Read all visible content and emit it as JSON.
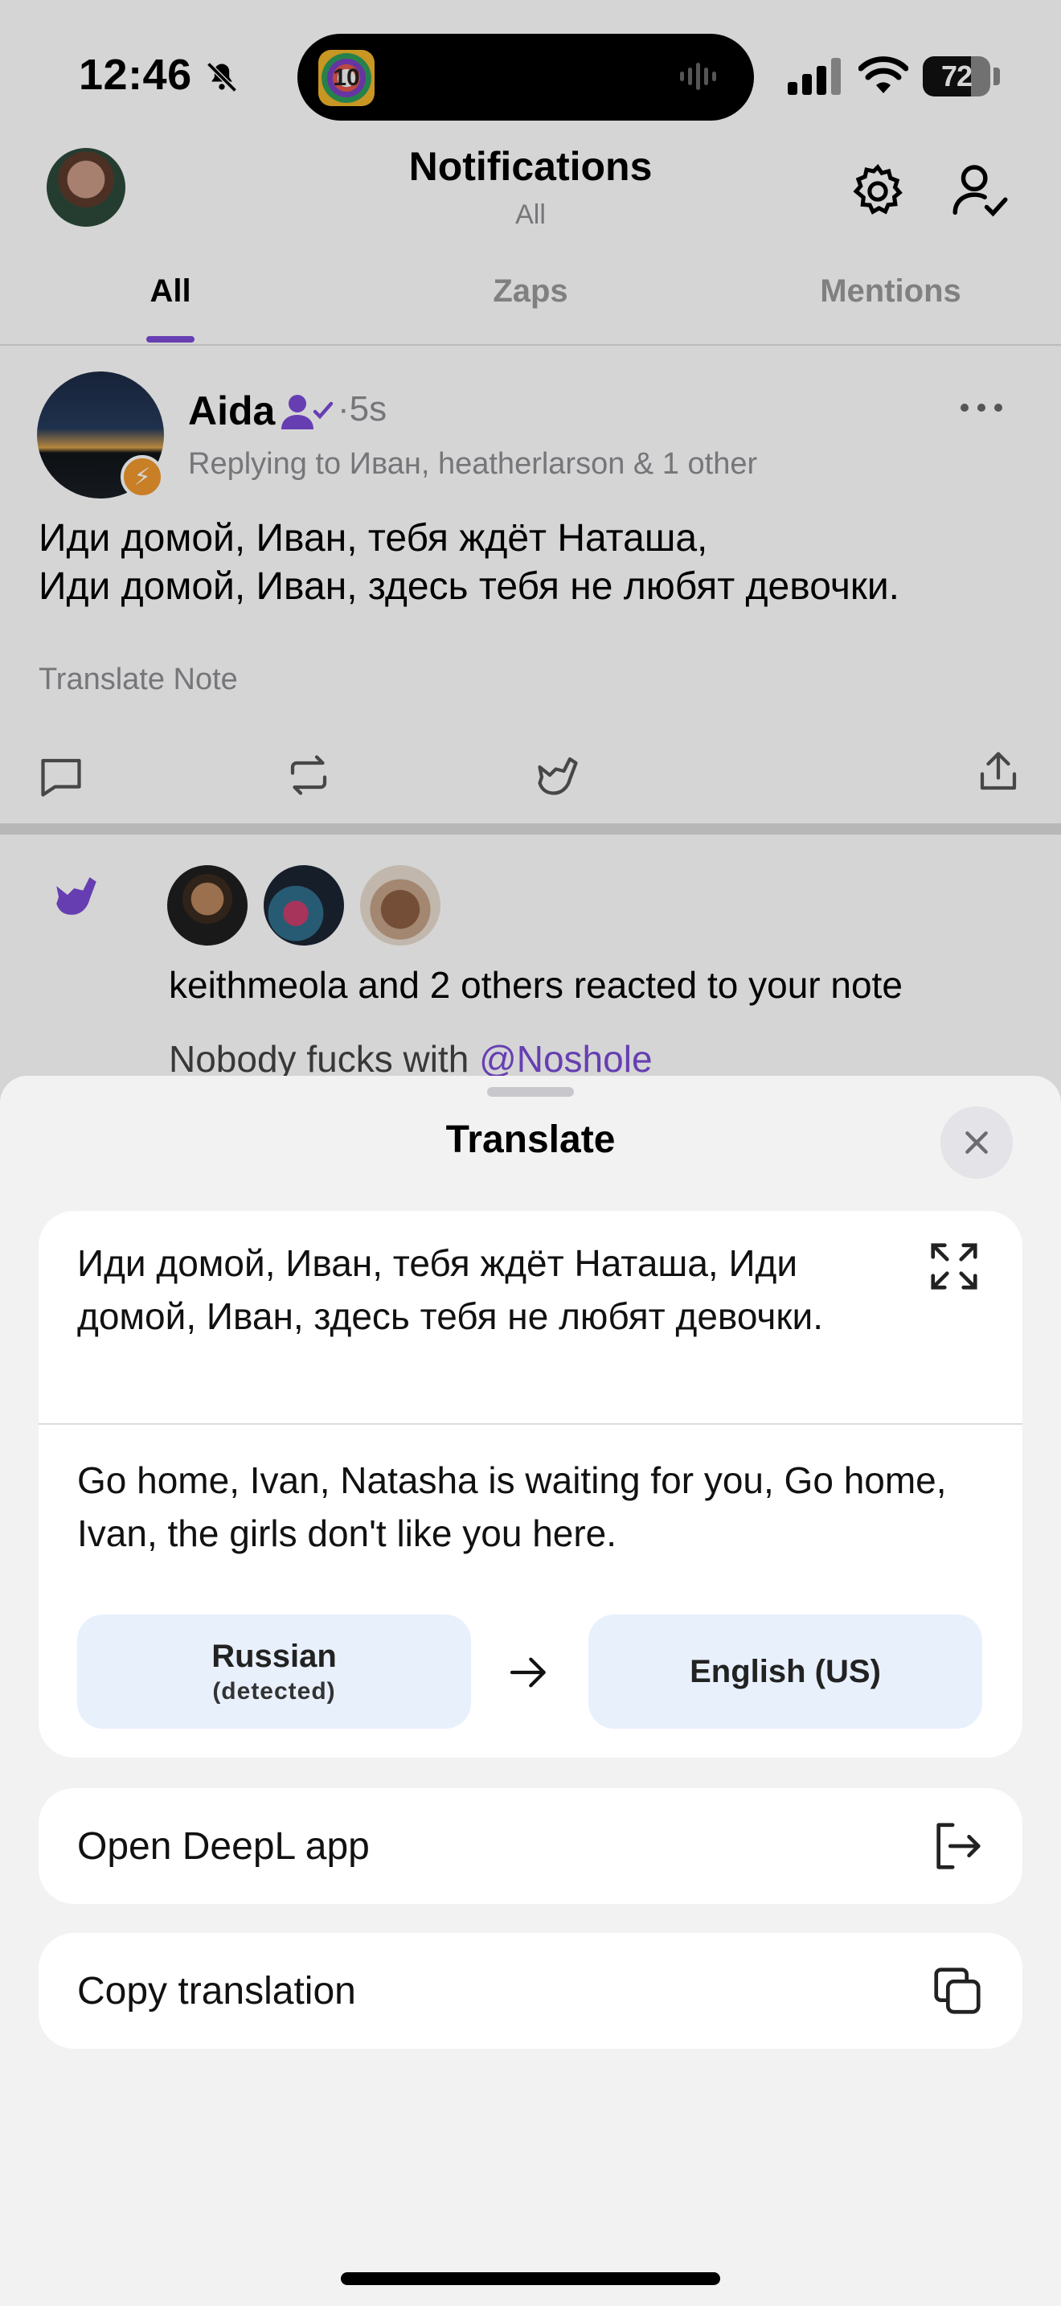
{
  "status_bar": {
    "time": "12:46",
    "battery": "72",
    "battery_level_percent": 72,
    "island_app_badge": "10",
    "icons": [
      "bell-slash-icon",
      "cellular-signal-icon",
      "wifi-icon",
      "battery-icon"
    ]
  },
  "header": {
    "title": "Notifications",
    "subtitle": "All",
    "icons": [
      "settings-gear-icon",
      "user-check-icon"
    ]
  },
  "tabs": [
    {
      "label": "All",
      "active": true
    },
    {
      "label": "Zaps",
      "active": false
    },
    {
      "label": "Mentions",
      "active": false
    }
  ],
  "post": {
    "author": "Aida",
    "time": "·5s",
    "replying_to": "Replying to Иван, heatherlarson & 1 other",
    "body_line1": "Иди домой, Иван, тебя ждёт Наташа,",
    "body_line2": "Иди домой, Иван, здесь тебя не любят девочки.",
    "translate_label": "Translate Note",
    "actions": [
      "reply-icon",
      "repost-icon",
      "shaka-icon",
      "share-icon"
    ]
  },
  "reaction": {
    "text": "keithmeola and 2 others reacted to your note",
    "quote_prefix": "Nobody fucks with ",
    "quote_mention": "@Noshole"
  },
  "sheet": {
    "title": "Translate",
    "source_text": "Иди домой, Иван, тебя ждёт Наташа, Иди домой, Иван, здесь тебя не любят девочки.",
    "translated_text": "Go home, Ivan, Natasha is waiting for you, Go home, Ivan, the girls don't like you here.",
    "source_language": "Russian",
    "source_detected": "(detected)",
    "target_language": "English (US)",
    "open_app_label": "Open DeepL app",
    "copy_label": "Copy translation"
  },
  "colors": {
    "accent_purple": "#7b4bd6",
    "zap_orange": "#f0982e",
    "language_button_bg": "#e8f0fc",
    "sheet_bg": "#f2f2f2"
  }
}
